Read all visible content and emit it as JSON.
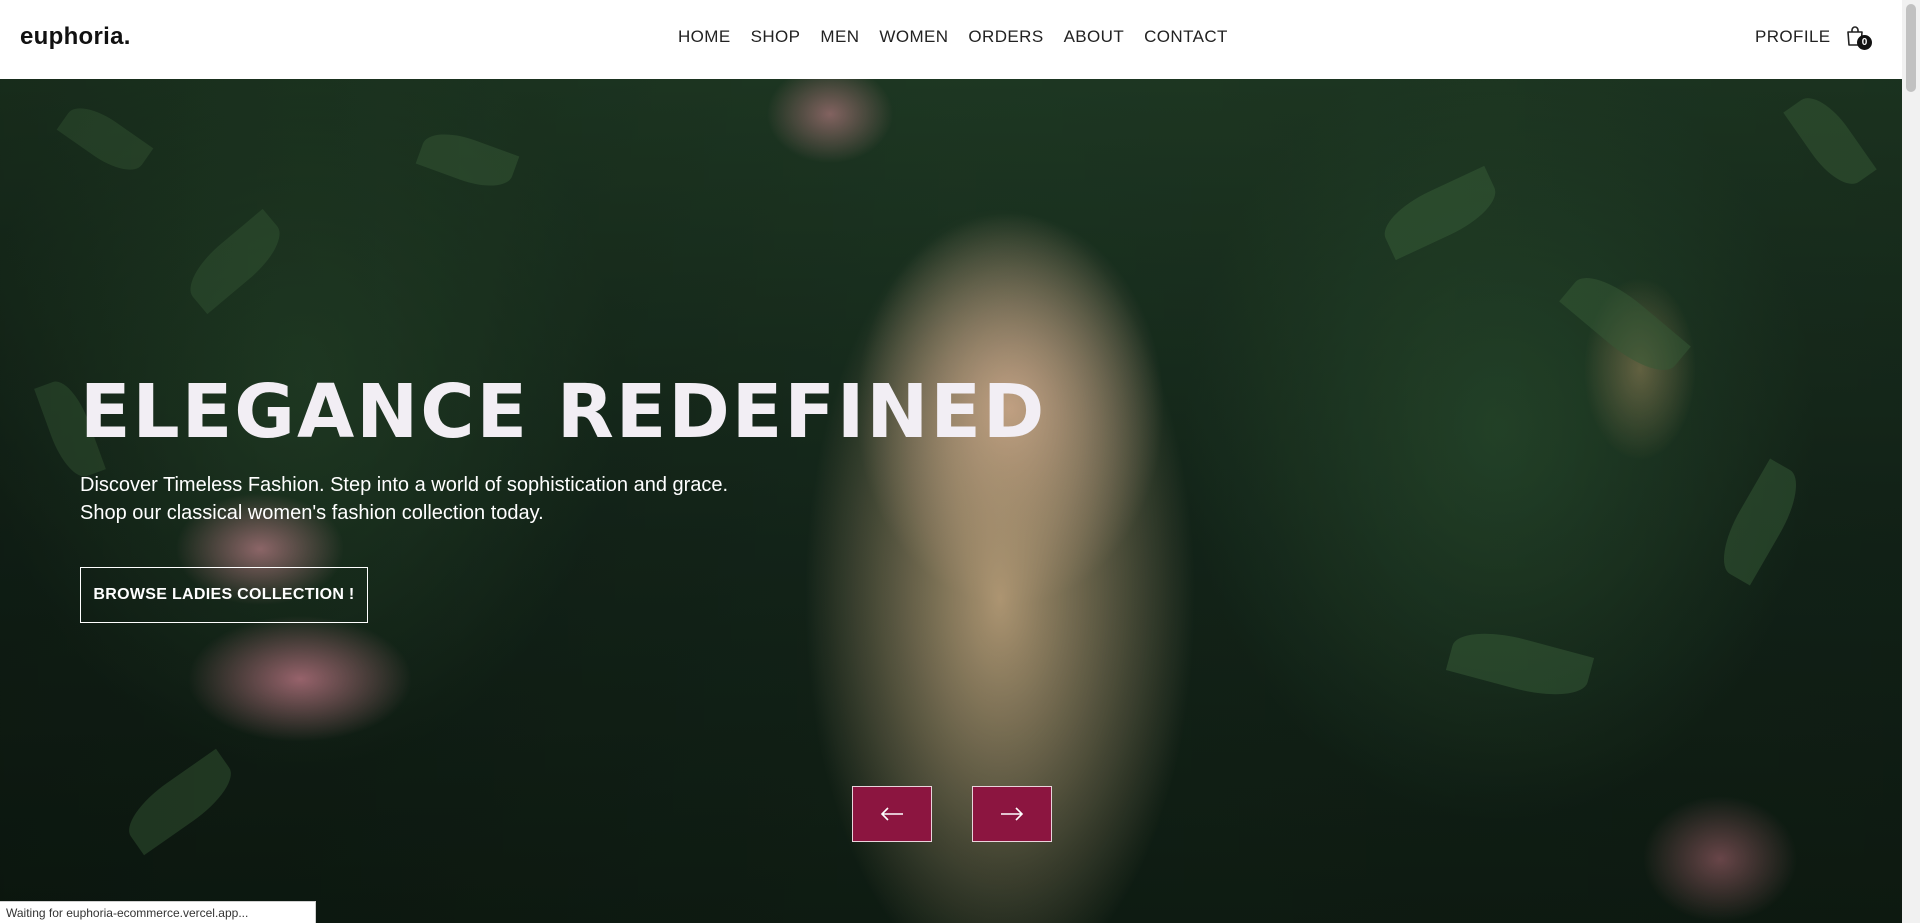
{
  "brand": {
    "logo": "euphoria."
  },
  "nav": {
    "links": [
      "HOME",
      "SHOP",
      "MEN",
      "WOMEN",
      "ORDERS",
      "ABOUT",
      "CONTACT"
    ],
    "profile": "PROFILE",
    "cart_count": "0"
  },
  "hero": {
    "title": "ELEGANCE REDEFINED",
    "subtitle_line1": "Discover Timeless Fashion. Step into a world of sophistication and grace.",
    "subtitle_line2": "Shop our classical women's fashion collection today.",
    "cta": "BROWSE LADIES COLLECTION !"
  },
  "carousel": {
    "prev_icon": "arrow-left-icon",
    "next_icon": "arrow-right-icon"
  },
  "status": {
    "text": "Waiting for euphoria-ecommerce.vercel.app..."
  },
  "colors": {
    "accent": "#8c1540",
    "nav_text": "#222222",
    "title": "#f2eef4"
  }
}
